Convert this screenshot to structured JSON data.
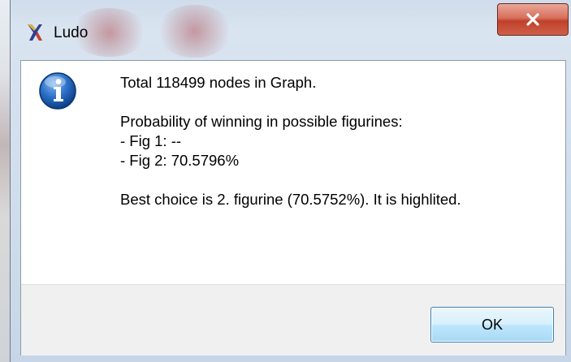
{
  "window": {
    "title": "Ludo",
    "app_icon": "ludo-app-icon",
    "close_icon": "close-icon"
  },
  "message": {
    "icon": "information-icon",
    "line1": "Total 118499 nodes in Graph.",
    "line2": "Probability of winning in possible figurines:",
    "line3": "- Fig 1: --",
    "line4": "- Fig 2: 70.5796%",
    "line5": "Best choice is 2. figurine (70.5752%). It is highlited."
  },
  "buttons": {
    "ok_label": "OK"
  },
  "colors": {
    "close_button": "#c7432d",
    "ok_border": "#3c7fb1",
    "info_icon": "#1d5fb6"
  }
}
